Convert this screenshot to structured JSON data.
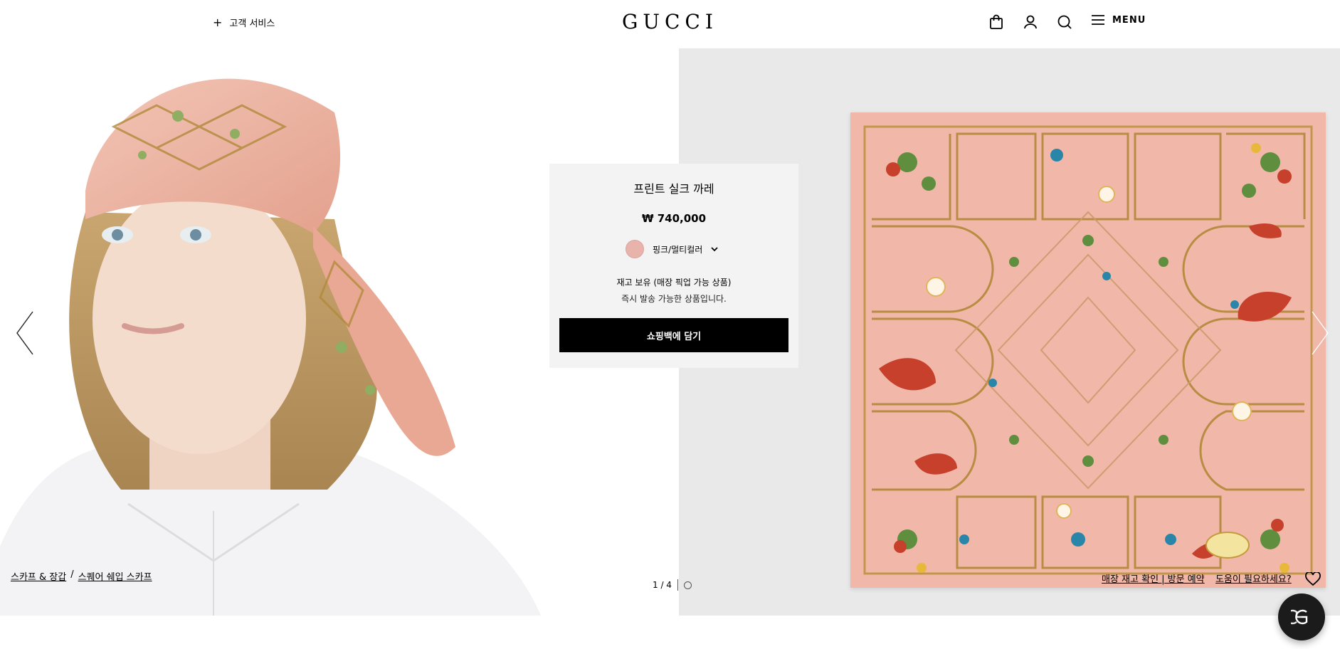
{
  "header": {
    "customer_service": "고객 서비스",
    "logo": "GUCCI",
    "menu_label": "MENU"
  },
  "product": {
    "title": "프린트 실크 까레",
    "price": "₩ 740,000",
    "color_label": "핑크/멀티컬러",
    "color_swatch": "#e7b3ab",
    "stock_status": "재고 보유 (매장 픽업 가능 상품)",
    "shipping_status": "즉시 발송 가능한 상품입니다.",
    "add_to_bag": "쇼핑백에 담기"
  },
  "breadcrumb": {
    "category": "스카프 & 장갑",
    "separator": "/",
    "subcategory": "스퀘어 쉐입 스카프"
  },
  "pager": {
    "label": "1 / 4"
  },
  "footer_links": {
    "store_booking": "매장 재고 확인 | 방문 예약",
    "help": "도움이 필요하세요?"
  },
  "icons": [
    "plus-icon",
    "shopping-bag-icon",
    "user-icon",
    "search-icon",
    "hamburger-icon",
    "chevron-down-icon",
    "arrow-left-icon",
    "arrow-right-icon",
    "heart-icon",
    "gucci-chat-icon"
  ],
  "colors": {
    "scarf_pink": "#f1b7a9",
    "right_bg": "#e9e9e9",
    "button_bg": "#000000"
  }
}
